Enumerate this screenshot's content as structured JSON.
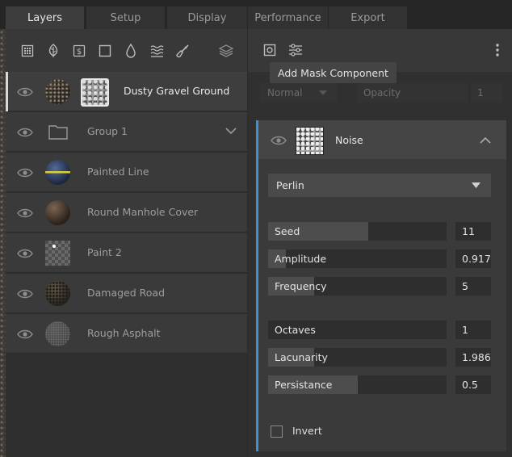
{
  "tabs": [
    {
      "label": "Layers",
      "active": true
    },
    {
      "label": "Setup",
      "active": false
    },
    {
      "label": "Display",
      "active": false
    },
    {
      "label": "Performance",
      "active": false
    },
    {
      "label": "Export",
      "active": false
    }
  ],
  "left_toolbar": {
    "icons": [
      "grid-fill-icon",
      "leaf-icon",
      "dollar-icon",
      "square-icon",
      "drop-icon",
      "waves-icon",
      "brush-icon",
      "layers-stack-icon"
    ]
  },
  "layers": [
    {
      "label": "Dusty Gravel Ground",
      "selected": true,
      "thumb": "gravel"
    },
    {
      "label": "Group 1",
      "selected": false,
      "thumb": "folder"
    },
    {
      "label": "Painted Line",
      "selected": false,
      "thumb": "painted-line"
    },
    {
      "label": "Round Manhole Cover",
      "selected": false,
      "thumb": "manhole"
    },
    {
      "label": "Paint 2",
      "selected": false,
      "thumb": "checker"
    },
    {
      "label": "Damaged Road",
      "selected": false,
      "thumb": "damaged-road"
    },
    {
      "label": "Rough Asphalt",
      "selected": false,
      "thumb": "asphalt"
    }
  ],
  "right_toolbar": {
    "icons": [
      "mask-add-icon",
      "sliders-icon",
      "more-vertical-icon"
    ],
    "tooltip": "Add Mask Component"
  },
  "blend": {
    "mode": "Normal",
    "opacity_label": "Opacity",
    "opacity_value": "1"
  },
  "noise": {
    "title": "Noise",
    "type": "Perlin",
    "params": [
      {
        "label": "Seed",
        "value": "11",
        "fill": 0.56
      },
      {
        "label": "Amplitude",
        "value": "0.917",
        "fill": 0.1
      },
      {
        "label": "Frequency",
        "value": "5",
        "fill": 0.26
      },
      {
        "label": "Octaves",
        "value": "1",
        "fill": 0.0
      },
      {
        "label": "Lacunarity",
        "value": "1.986",
        "fill": 0.26
      },
      {
        "label": "Persistance",
        "value": "0.5",
        "fill": 0.5
      }
    ],
    "invert_label": "Invert",
    "invert_checked": false
  },
  "colors": {
    "accent": "#3d8fd6",
    "panel": "#3a3a3a",
    "background": "#2b2b2b"
  }
}
